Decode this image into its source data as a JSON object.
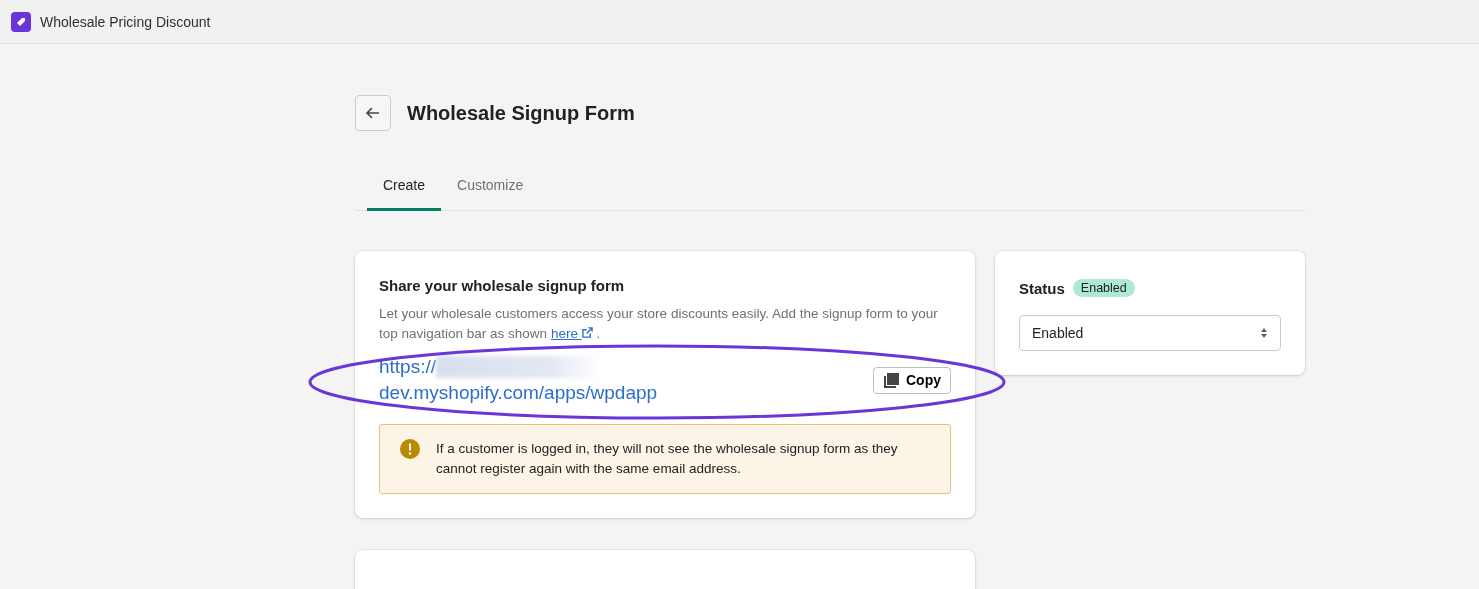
{
  "app_bar": {
    "title": "Wholesale Pricing Discount"
  },
  "page": {
    "title": "Wholesale Signup Form"
  },
  "tabs": [
    {
      "label": "Create",
      "selected": true
    },
    {
      "label": "Customize",
      "selected": false
    }
  ],
  "share_card": {
    "heading": "Share your wholesale signup form",
    "description": "Let your wholesale customers access your store discounts easily. Add the signup form to your top navigation bar as shown",
    "link": "here",
    "after_link": ".",
    "url_line_1": "https://",
    "url_redacted": true,
    "url_line_2": "dev.myshopify.com/apps/wpdapp",
    "copy_button": "Copy",
    "warning": "If a customer is logged in, they will not see the wholesale signup form as they cannot register again with the same email address."
  },
  "status_card": {
    "heading": "Status",
    "badge": "Enabled",
    "select_value": "Enabled"
  },
  "annotation": {
    "kind": "ellipse",
    "color": "#6a35d9"
  }
}
